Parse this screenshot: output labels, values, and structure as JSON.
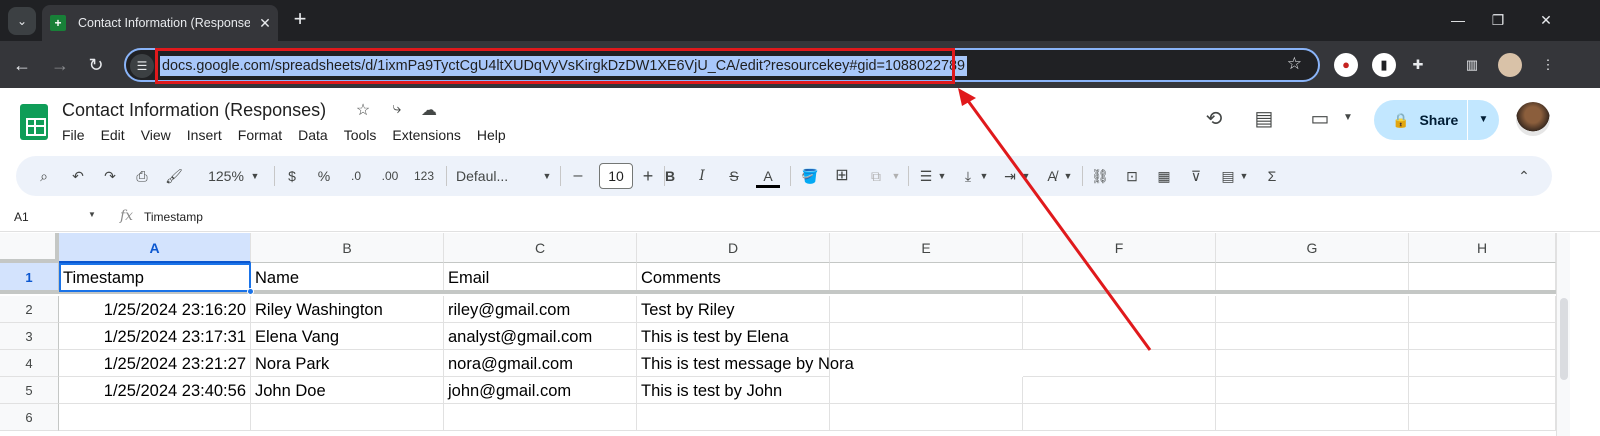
{
  "browser": {
    "tab_title": "Contact Information (Responses)",
    "tab_close": "✕",
    "new_tab": "+",
    "url": "docs.google.com/spreadsheets/d/1ixmPa9TyctCgU4ltXUDqVyVsKirgkDzDW1XE6VjU_CA/edit?resourcekey#gid=1088022789"
  },
  "sheets": {
    "doc_title": "Contact Information (Responses)",
    "menu": [
      "File",
      "Edit",
      "View",
      "Insert",
      "Format",
      "Data",
      "Tools",
      "Extensions",
      "Help"
    ],
    "share_label": "Share",
    "toolbar": {
      "zoom": "125%",
      "currency": "$",
      "percent": "%",
      "dec_decrease": ".0",
      "dec_increase": ".00",
      "number_format": "123",
      "font": "Defaul...",
      "font_size": "10",
      "minus": "–",
      "plus": "+",
      "bold": "B",
      "italic": "I",
      "strike": "S",
      "text_color": "A"
    },
    "namebox": "A1",
    "fx": "fx",
    "formula_value": "Timestamp"
  },
  "grid": {
    "columns": [
      "A",
      "B",
      "C",
      "D",
      "E",
      "F",
      "G",
      "H"
    ],
    "row_numbers": [
      "1",
      "2",
      "3",
      "4",
      "5",
      "6"
    ],
    "header_row": [
      "Timestamp",
      "Name",
      "Email",
      "Comments"
    ],
    "rows": [
      [
        "1/25/2024 23:16:20",
        "Riley Washington",
        "riley@gmail.com",
        "Test by Riley"
      ],
      [
        "1/25/2024 23:17:31",
        "Elena Vang",
        "analyst@gmail.com",
        "This is test by Elena"
      ],
      [
        "1/25/2024 23:21:27",
        "Nora Park",
        "nora@gmail.com",
        "This is test message by Nora"
      ],
      [
        "1/25/2024 23:40:56",
        "John Doe",
        "john@gmail.com",
        "This is test by John"
      ]
    ]
  },
  "colors": {
    "highlight_red": "#e0191c",
    "selection_blue": "#1a73e8",
    "share_bg": "#c2e7ff",
    "sheets_green": "#0f9d58"
  }
}
